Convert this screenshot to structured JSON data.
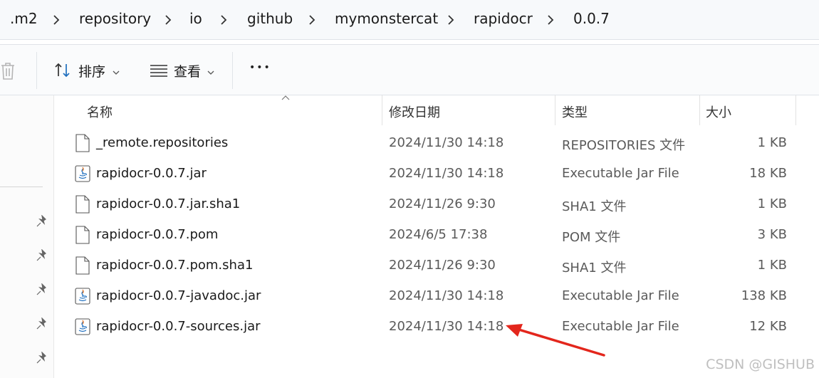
{
  "breadcrumb": {
    "segments": [
      ".m2",
      "repository",
      "io",
      "github",
      "mymonstercat",
      "rapidocr",
      "0.0.7"
    ]
  },
  "toolbar": {
    "sort_label": "排序",
    "view_label": "查看",
    "more_label": "•••"
  },
  "columns": {
    "name": "名称",
    "date": "修改日期",
    "type": "类型",
    "size": "大小"
  },
  "files": [
    {
      "name": "_remote.repositories",
      "date": "2024/11/30 14:18",
      "type": "REPOSITORIES 文件",
      "size": "1 KB",
      "icon": "document-icon"
    },
    {
      "name": "rapidocr-0.0.7.jar",
      "date": "2024/11/30 14:18",
      "type": "Executable Jar File",
      "size": "18 KB",
      "icon": "java-jar-icon"
    },
    {
      "name": "rapidocr-0.0.7.jar.sha1",
      "date": "2024/11/26 9:30",
      "type": "SHA1 文件",
      "size": "1 KB",
      "icon": "document-icon"
    },
    {
      "name": "rapidocr-0.0.7.pom",
      "date": "2024/6/5 17:38",
      "type": "POM 文件",
      "size": "3 KB",
      "icon": "document-icon"
    },
    {
      "name": "rapidocr-0.0.7.pom.sha1",
      "date": "2024/11/26 9:30",
      "type": "SHA1 文件",
      "size": "1 KB",
      "icon": "document-icon"
    },
    {
      "name": "rapidocr-0.0.7-javadoc.jar",
      "date": "2024/11/30 14:18",
      "type": "Executable Jar File",
      "size": "138 KB",
      "icon": "java-jar-icon"
    },
    {
      "name": "rapidocr-0.0.7-sources.jar",
      "date": "2024/11/30 14:18",
      "type": "Executable Jar File",
      "size": "12 KB",
      "icon": "java-jar-icon"
    }
  ],
  "watermark": "CSDN @GISHUB",
  "colors": {
    "annotation_arrow": "#e3261c",
    "java_icon_accent": "#1f6fbf"
  }
}
